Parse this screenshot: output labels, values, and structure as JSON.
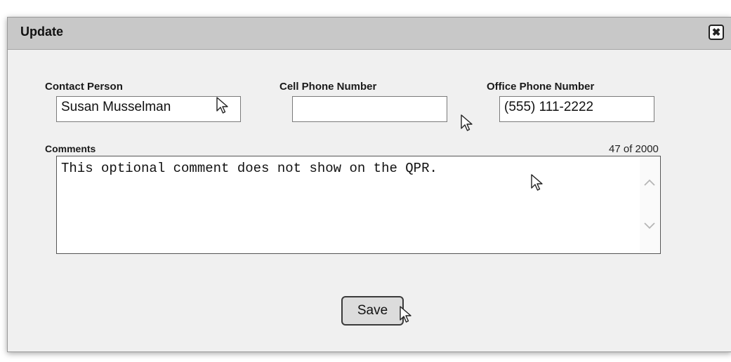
{
  "dialog": {
    "title": "Update",
    "close_label": "✖"
  },
  "form": {
    "contact_person": {
      "label": "Contact Person",
      "value": "Susan Musselman"
    },
    "cell_phone": {
      "label": "Cell Phone Number",
      "value": ""
    },
    "office_phone": {
      "label": "Office Phone Number",
      "value": "(555) 111-2222"
    },
    "comments": {
      "label": "Comments",
      "counter": "47 of 2000",
      "value": "This optional comment does not show on the QPR."
    },
    "save_label": "Save"
  },
  "icons": {
    "close": "close-icon",
    "cursor": "mouse-pointer-icon",
    "scroll_up": "chevron-up-icon",
    "scroll_down": "chevron-down-icon"
  }
}
